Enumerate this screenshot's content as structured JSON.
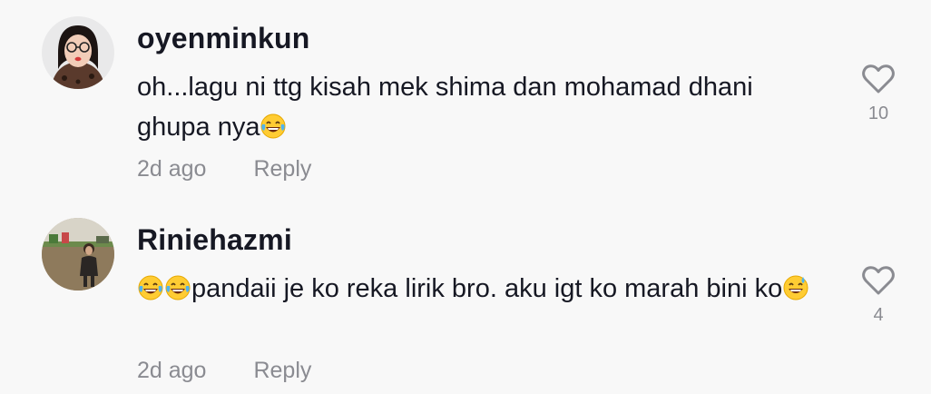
{
  "comments": [
    {
      "username": "oyenminkun",
      "text_part1": "oh...lagu ni ttg kisah mek shima dan mohamad dhani ghupa nya",
      "text_emoji": "laughing-crying-emoji",
      "time": "2d ago",
      "reply_label": "Reply",
      "likes": "10",
      "avatar_icon": "avatar-woman-glasses"
    },
    {
      "username": "Riniehazmi",
      "text_part1": "pandaii je ko reka lirik bro. aku igt ko marah bini ko",
      "text_emoji": "grinning-sweat-emoji",
      "time": "2d ago",
      "reply_label": "Reply",
      "likes": "4",
      "avatar_icon": "avatar-person-outdoor"
    }
  ],
  "colors": {
    "background": "#f8f8f8",
    "primary_text": "#161823",
    "secondary_text": "#8a8b91"
  }
}
